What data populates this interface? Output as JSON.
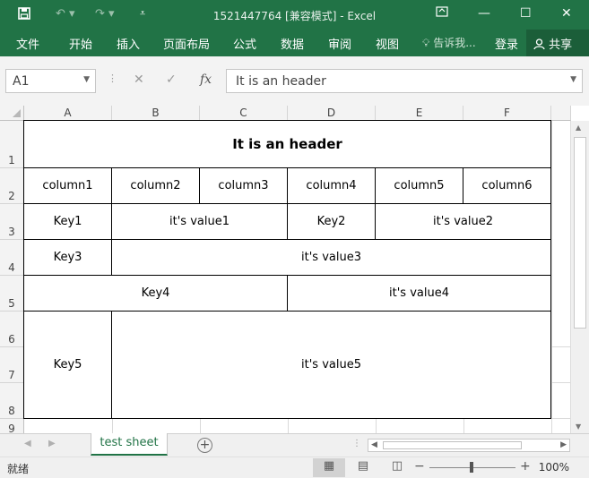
{
  "window": {
    "title": "1521447764  [兼容模式] - Excel",
    "controls": [
      "restore-ribbon",
      "minimize",
      "maximize",
      "close"
    ]
  },
  "quick_access": {
    "save_icon": "save-icon",
    "undo_icon": "undo-icon",
    "redo_icon": "redo-icon",
    "customize_icon": "customize-icon"
  },
  "ribbon": {
    "tabs": [
      "文件",
      "开始",
      "插入",
      "页面布局",
      "公式",
      "数据",
      "审阅",
      "视图"
    ],
    "tell_me": "告诉我...",
    "login": "登录",
    "share": "共享"
  },
  "formula_bar": {
    "name_box": "A1",
    "fx_label": "fx",
    "formula_value": "It is an header"
  },
  "sheet": {
    "columns": [
      "A",
      "B",
      "C",
      "D",
      "E",
      "F"
    ],
    "rows": [
      "1",
      "2",
      "3",
      "4",
      "5",
      "6",
      "7",
      "8",
      "9"
    ],
    "header": "It is an header",
    "row2": [
      "column1",
      "column2",
      "column3",
      "column4",
      "column5",
      "column6"
    ],
    "row3": {
      "key1": "Key1",
      "value1": "it's value1",
      "key2": "Key2",
      "value2": "it's value2"
    },
    "row4": {
      "key3": "Key3",
      "value3": "it's value3"
    },
    "row5": {
      "key4": "Key4",
      "value4": "it's value4"
    },
    "row678": {
      "key5": "Key5",
      "value5": "it's value5"
    }
  },
  "sheet_tabs": {
    "active": "test sheet",
    "add_icon": "plus-icon"
  },
  "status_bar": {
    "ready": "就绪",
    "zoom": "100%",
    "views": [
      "normal-view-icon",
      "page-layout-icon",
      "page-break-icon"
    ]
  },
  "colors": {
    "brand": "#217346",
    "grid": "#dadada",
    "header_bg": "#f3f3f3"
  }
}
